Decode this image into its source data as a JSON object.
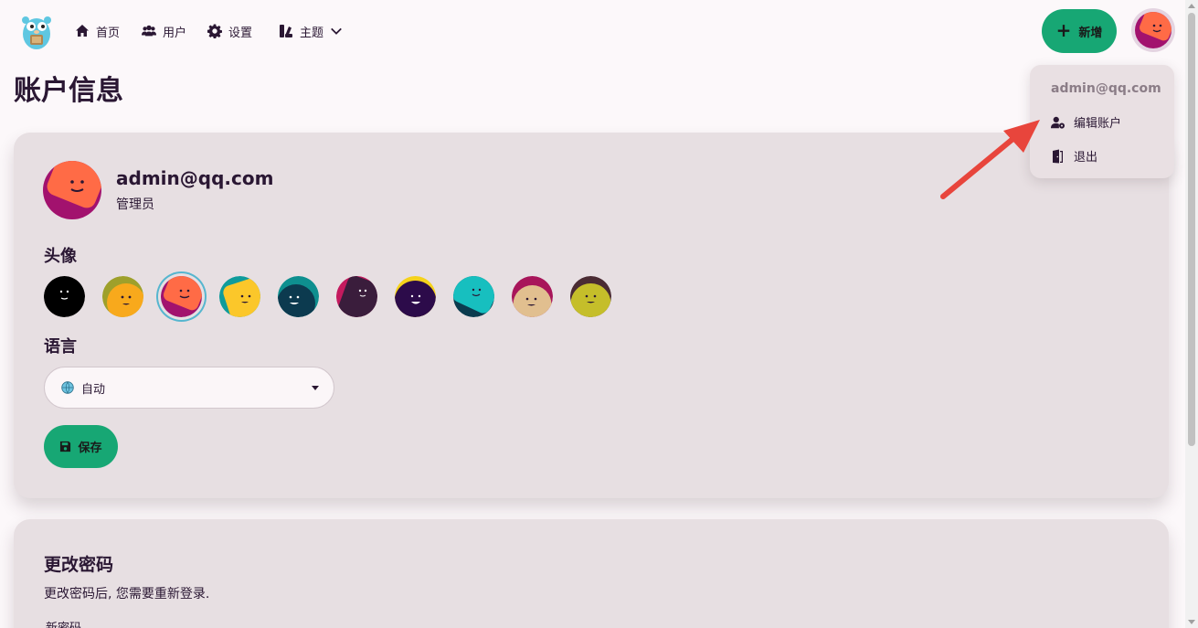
{
  "nav": {
    "home": "首页",
    "users": "用户",
    "settings": "设置",
    "theme": "主题",
    "add": "新增"
  },
  "page": {
    "title": "账户信息"
  },
  "profile": {
    "email": "admin@qq.com",
    "role": "管理员"
  },
  "avatar_section": {
    "label": "头像",
    "selected_index": 2
  },
  "language": {
    "label": "语言",
    "value": "自动"
  },
  "save_label": "保存",
  "password": {
    "title": "更改密码",
    "description": "更改密码后, 您需要重新登录.",
    "new_label": "新密码"
  },
  "menu": {
    "email": "admin@qq.com",
    "edit_account": "编辑账户",
    "logout": "退出"
  },
  "colors": {
    "accent": "#17a774",
    "selected_ring": "#56b6cf",
    "annotation_arrow": "#e8453c"
  }
}
